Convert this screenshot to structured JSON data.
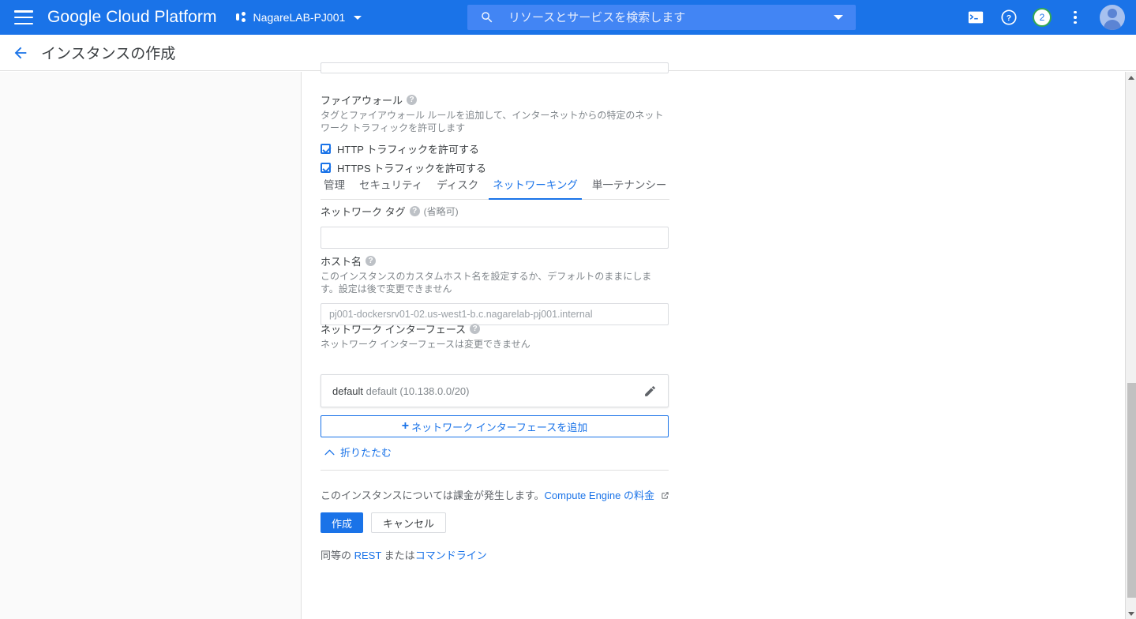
{
  "topbar": {
    "menu_icon": "hamburger-menu-icon",
    "brand": "Google Cloud Platform",
    "project_icon": "project-nodes-icon",
    "project_name": "NagareLAB-PJ001",
    "project_caret": "chevron-down-icon",
    "search": {
      "icon": "search-icon",
      "placeholder": "リソースとサービスを検索します",
      "value": "",
      "caret": "chevron-down-icon"
    },
    "icons": {
      "cloud_shell": "terminal-icon",
      "help": "help-circle-icon",
      "notifications_count": "2",
      "more": "kebab-menu-icon",
      "avatar": "user-avatar"
    },
    "colors": {
      "bar": "#1a73e8",
      "search_bg": "#4285f4",
      "badge_ring": "#34a853"
    }
  },
  "pageheader": {
    "back_icon": "back-arrow-icon",
    "title": "インスタンスの作成"
  },
  "form": {
    "firewall": {
      "label": "ファイアウォール",
      "help_icon": "help-circle-icon",
      "description": "タグとファイアウォール ルールを追加して、インターネットからの特定のネットワーク トラフィックを許可します",
      "checkboxes": [
        {
          "label": "HTTP トラフィックを許可する",
          "checked": true
        },
        {
          "label": "HTTPS トラフィックを許可する",
          "checked": true
        }
      ]
    },
    "tabs": [
      {
        "label": "管理",
        "active": false
      },
      {
        "label": "セキュリティ",
        "active": false
      },
      {
        "label": "ディスク",
        "active": false
      },
      {
        "label": "ネットワーキング",
        "active": true
      },
      {
        "label": "単一テナンシー",
        "active": false
      }
    ],
    "network_tag": {
      "label": "ネットワーク タグ",
      "help_icon": "help-circle-icon",
      "optional": "(省略可)",
      "value": "",
      "placeholder": ""
    },
    "hostname": {
      "label": "ホスト名",
      "help_icon": "help-circle-icon",
      "description": "このインスタンスのカスタムホスト名を設定するか、デフォルトのままにします。設定は後で変更できません",
      "value": "",
      "placeholder": "pj001-dockersrv01-02.us-west1-b.c.nagarelab-pj001.internal"
    },
    "network_interface": {
      "label": "ネットワーク インターフェース",
      "help_icon": "help-circle-icon",
      "description": "ネットワーク インターフェースは変更できません",
      "card": {
        "name": "default",
        "detail": "default (10.138.0.0/20)",
        "edit_icon": "pencil-edit-icon"
      },
      "add_button": {
        "plus_icon": "plus-icon",
        "label": "ネットワーク インターフェースを追加"
      }
    },
    "collapse_link": {
      "icon": "chevron-up-icon",
      "label": "折りたたむ"
    },
    "billing": {
      "text": "このインスタンスについては課金が発生します。",
      "link": "Compute Engine の料金",
      "external_icon": "external-link-icon"
    },
    "actions": {
      "create": "作成",
      "cancel": "キャンセル"
    },
    "equivalent": {
      "prefix": "同等の ",
      "rest_link": "REST",
      "middle": " または",
      "cmdline_link": "コマンドライン"
    }
  },
  "scrollbar": {
    "up_arrow": "scroll-up-arrow-icon",
    "down_arrow": "scroll-down-arrow-icon",
    "thumb": "scroll-thumb"
  }
}
